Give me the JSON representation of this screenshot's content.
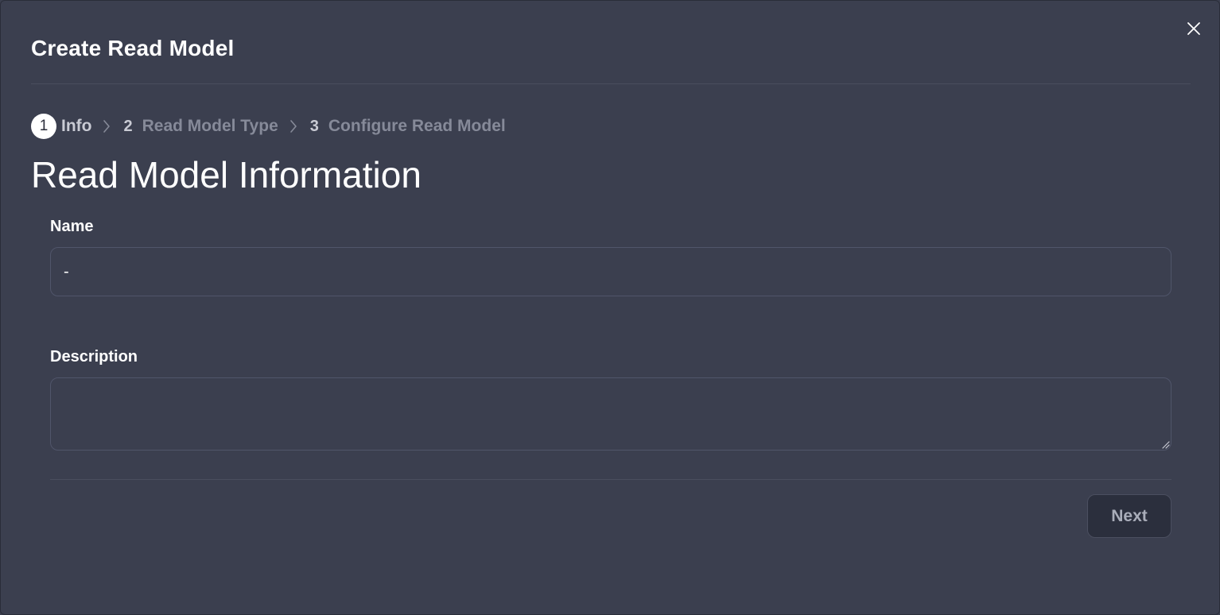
{
  "dialog": {
    "title": "Create Read Model",
    "close_icon": "close-icon"
  },
  "steps": [
    {
      "number": "1",
      "label": "Info",
      "active": true
    },
    {
      "number": "2",
      "label": "Read Model Type",
      "active": false
    },
    {
      "number": "3",
      "label": "Configure Read Model",
      "active": false
    }
  ],
  "section": {
    "title": "Read Model Information"
  },
  "form": {
    "name_label": "Name",
    "name_value": "-",
    "description_label": "Description",
    "description_value": ""
  },
  "footer": {
    "next_label": "Next"
  },
  "colors": {
    "background": "#3b3f4f",
    "button_bg": "#2b2f3d",
    "inactive_text": "#868a99"
  }
}
